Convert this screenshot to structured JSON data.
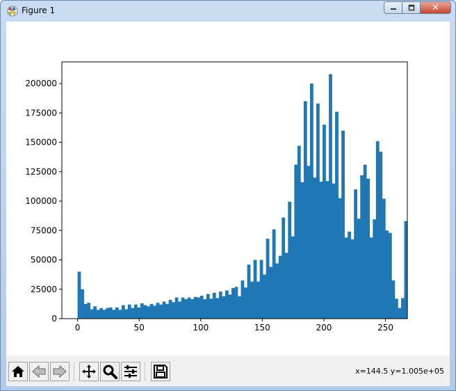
{
  "window": {
    "title": "Figure 1",
    "close_glyph": "✕"
  },
  "toolbar": {
    "buttons": [
      {
        "name": "home-icon"
      },
      {
        "name": "back-icon"
      },
      {
        "name": "forward-icon"
      },
      {
        "name": "pan-icon"
      },
      {
        "name": "zoom-icon"
      },
      {
        "name": "configure-subplots-icon"
      },
      {
        "name": "save-icon"
      }
    ],
    "coords": "x=144.5 y=1.005e+05"
  },
  "chart_data": {
    "type": "bar",
    "title": "",
    "xlabel": "",
    "ylabel": "",
    "xlim": [
      -12.75,
      267.75
    ],
    "ylim": [
      0,
      218400
    ],
    "xticks": [
      0,
      50,
      100,
      150,
      200,
      250
    ],
    "yticks": [
      0,
      25000,
      50000,
      75000,
      100000,
      125000,
      150000,
      175000,
      200000
    ],
    "bin_width": 2.55,
    "x_start": 0,
    "values": [
      40000,
      25000,
      12500,
      13500,
      8000,
      10500,
      7500,
      9000,
      7500,
      9000,
      9500,
      7500,
      9500,
      7500,
      11500,
      8000,
      12000,
      9000,
      12000,
      9500,
      13000,
      11500,
      10500,
      12500,
      11000,
      13500,
      12000,
      14500,
      12500,
      16000,
      14000,
      18000,
      14500,
      18000,
      16500,
      18000,
      16500,
      18500,
      18000,
      19500,
      16500,
      21000,
      17000,
      22000,
      17500,
      23000,
      19000,
      24000,
      20500,
      26000,
      27000,
      19000,
      32500,
      26500,
      46000,
      31500,
      50000,
      31500,
      50000,
      37500,
      68000,
      44000,
      76000,
      47000,
      53500,
      86000,
      56000,
      99500,
      70000,
      131000,
      147000,
      116000,
      185000,
      130000,
      200000,
      120000,
      183000,
      116500,
      165000,
      117000,
      208000,
      115000,
      176000,
      102500,
      160000,
      69000,
      74000,
      67500,
      110000,
      85000,
      122000,
      131000,
      119000,
      69000,
      84500,
      151000,
      142000,
      102000,
      75000,
      73000,
      32500,
      17000,
      9000,
      17500,
      83000
    ]
  }
}
